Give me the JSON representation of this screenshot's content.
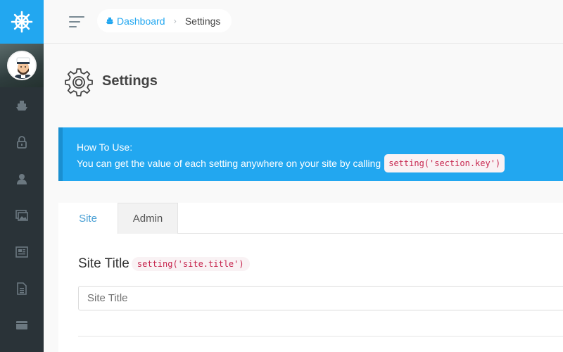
{
  "breadcrumb": {
    "home": "Dashboard",
    "current": "Settings"
  },
  "page": {
    "title": "Settings"
  },
  "alert": {
    "title": "How To Use:",
    "body": "You can get the value of each setting anywhere on your site by calling",
    "code": "setting('section.key')"
  },
  "tabs": [
    {
      "label": "Site",
      "active": true
    },
    {
      "label": "Admin",
      "active": false
    }
  ],
  "field": {
    "label": "Site Title",
    "code": "setting('site.title')",
    "placeholder": "Site Title"
  },
  "sidebar": {
    "items": [
      {
        "icon": "boat-icon"
      },
      {
        "icon": "lock-icon"
      },
      {
        "icon": "user-icon"
      },
      {
        "icon": "images-icon"
      },
      {
        "icon": "news-icon"
      },
      {
        "icon": "document-icon"
      },
      {
        "icon": "folder-icon"
      }
    ]
  },
  "colors": {
    "accent": "#22a7f0",
    "sidebar": "#2a3338",
    "code_text": "#c7254e",
    "code_bg": "#f9f2f4"
  }
}
